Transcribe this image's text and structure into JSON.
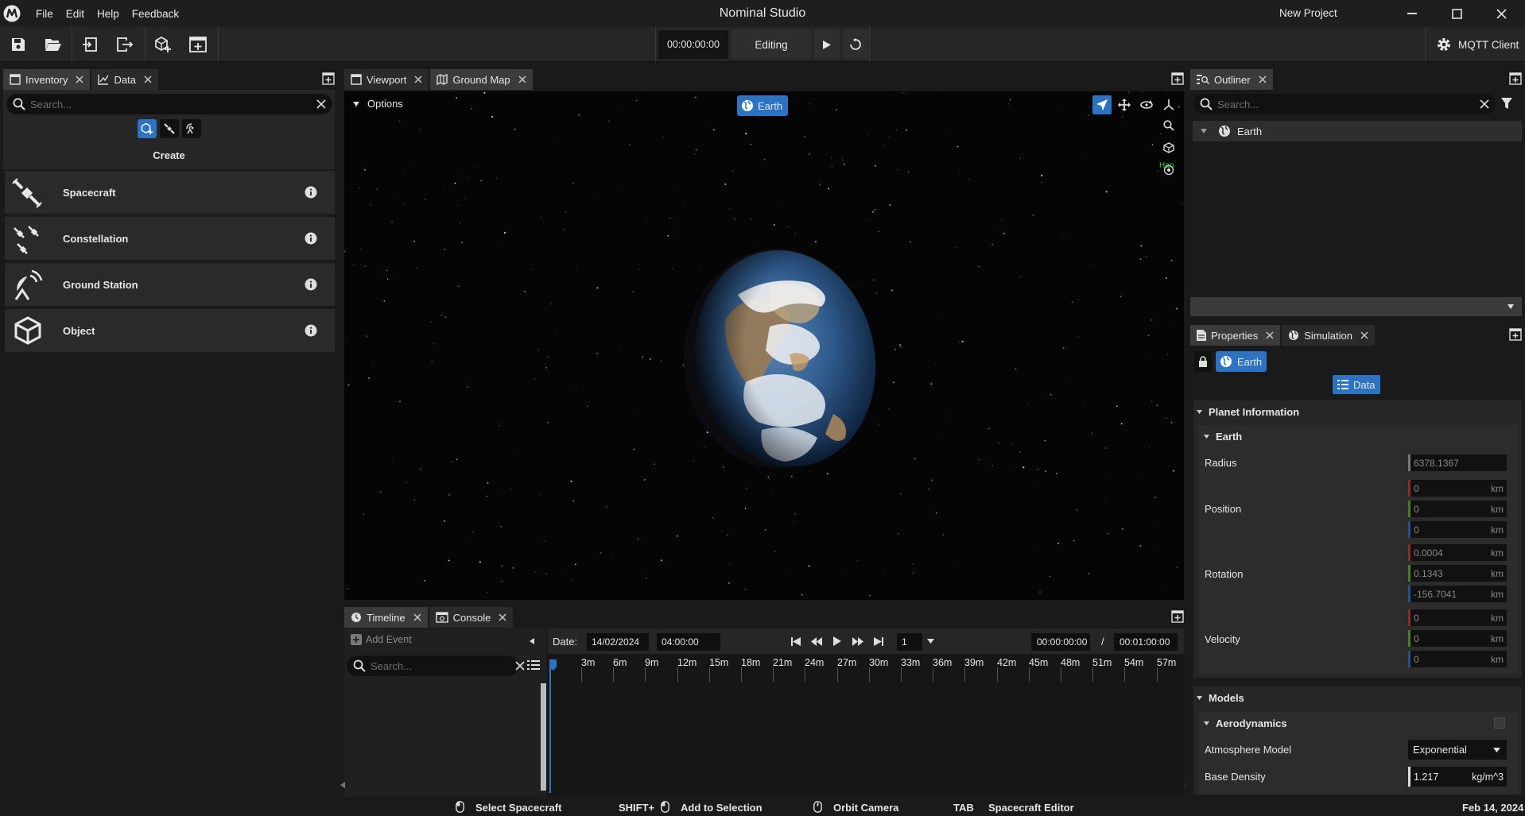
{
  "app": {
    "title": "Nominal Studio",
    "project": "New Project",
    "menu": [
      "File",
      "Edit",
      "Help",
      "Feedback"
    ]
  },
  "toolbar": {
    "time": "00:00:00:00",
    "mode": "Editing",
    "mqtt_label": "MQTT Client"
  },
  "left_panel": {
    "tabs": [
      {
        "label": "Inventory"
      },
      {
        "label": "Data"
      }
    ],
    "search_placeholder": "Search...",
    "create_label": "Create",
    "items": [
      {
        "label": "Spacecraft",
        "icon": "spacecraft-icon"
      },
      {
        "label": "Constellation",
        "icon": "constellation-icon"
      },
      {
        "label": "Ground Station",
        "icon": "ground-station-icon"
      },
      {
        "label": "Object",
        "icon": "object-cube-icon"
      }
    ]
  },
  "viewport": {
    "tabs": [
      {
        "label": "Viewport"
      },
      {
        "label": "Ground Map"
      }
    ],
    "active_tab": "Ground Map",
    "options_label": "Options",
    "focus_chip": "Earth",
    "overlay_text": "Han"
  },
  "timeline": {
    "tabs": [
      {
        "label": "Timeline"
      },
      {
        "label": "Console"
      }
    ],
    "add_event": "Add Event",
    "search_placeholder": "Search...",
    "date_label": "Date:",
    "date": "14/02/2024",
    "time": "04:00:00",
    "speed": "1",
    "current": "00:00:00:00",
    "separator": "/",
    "duration": "00:01:00:00",
    "ticks": [
      "3m",
      "6m",
      "9m",
      "12m",
      "15m",
      "18m",
      "21m",
      "24m",
      "27m",
      "30m",
      "33m",
      "36m",
      "39m",
      "42m",
      "45m",
      "48m",
      "51m",
      "54m",
      "57m"
    ]
  },
  "outliner": {
    "tab": "Outliner",
    "search_placeholder": "Search...",
    "tree": [
      {
        "label": "Earth"
      }
    ]
  },
  "properties": {
    "tabs": [
      {
        "label": "Properties"
      },
      {
        "label": "Simulation"
      }
    ],
    "selected_chip": "Earth",
    "data_button": "Data",
    "planet_section": "Planet Information",
    "planet_name": "Earth",
    "radius_label": "Radius",
    "radius": "6378.1367",
    "position_label": "Position",
    "position": [
      "0",
      "0",
      "0"
    ],
    "rotation_label": "Rotation",
    "rotation": [
      "0.0004",
      "0.1343",
      "-156.7041"
    ],
    "velocity_label": "Velocity",
    "velocity": [
      "0",
      "0",
      "0"
    ],
    "unit_km": "km",
    "models_section": "Models",
    "aero_section": "Aerodynamics",
    "atmosphere_label": "Atmosphere Model",
    "atmosphere_value": "Exponential",
    "base_density_label": "Base Density",
    "base_density": "1.217",
    "base_density_unit": "kg/m^3"
  },
  "statusbar": {
    "hint1": "Select Spacecraft",
    "shift": "SHIFT+",
    "hint2": "Add to Selection",
    "hint3": "Orbit Camera",
    "tab_key": "TAB",
    "hint4": "Spacecraft Editor",
    "date": "Feb 14, 2024"
  },
  "colors": {
    "accent": "#2d73c4",
    "axis_x": "#8a2a2a",
    "axis_y": "#4e7a2a",
    "axis_z": "#2a4f8a"
  }
}
